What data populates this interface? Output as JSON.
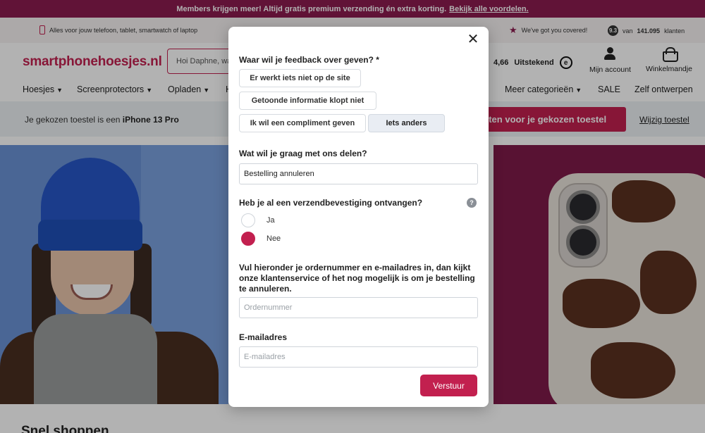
{
  "promo": {
    "text": "Members krijgen meer! Altijd gratis premium verzending én extra korting.",
    "link": "Bekijk alle voordelen."
  },
  "usp": {
    "devices": "Alles voor jouw telefoon, tablet, smartwatch of laptop",
    "covered": "We've got you covered!",
    "rating_badge": "9.3",
    "rating_prefix": "van",
    "rating_count": "141.095",
    "rating_suffix": "klanten"
  },
  "header": {
    "logo": "smartphonehoesjes.nl",
    "search_text": "Hoi Daphne, wa",
    "review_score": "4,66",
    "review_label": "Uitstekend",
    "review_icon_letter": "e",
    "account": "Mijn account",
    "basket": "Winkelmandje"
  },
  "nav": {
    "items": [
      "Hoesjes",
      "Screenprotectors",
      "Opladen",
      "H"
    ],
    "more": "Meer categorieën",
    "sale": "SALE",
    "custom": "Zelf ontwerpen"
  },
  "device_bar": {
    "text_prefix": "Je gekozen toestel is een",
    "device": "iPhone 13 Pro",
    "cta": "cten voor je gekozen toestel",
    "change": "Wijzig toestel"
  },
  "below": {
    "heading": "Snel shoppen"
  },
  "modal": {
    "q1": "Waar wil je feedback over geven? *",
    "options": [
      "Er werkt iets niet op de site",
      "Getoonde informatie klopt niet",
      "Ik wil een compliment geven",
      "Iets anders"
    ],
    "selected_option": "Iets anders",
    "q2": "Wat wil je graag met ons delen?",
    "q2_value": "Bestelling annuleren",
    "q3": "Heb je al een verzendbevestiging ontvangen?",
    "help": "?",
    "radio_yes": "Ja",
    "radio_no": "Nee",
    "radio_selected": "Nee",
    "info": "Vul hieronder je ordernummer en e-mailadres in, dan kijkt onze klantenservice of het nog mogelijk is om je bestelling te annuleren.",
    "order_placeholder": "Ordernummer",
    "email_label": "E-mailadres",
    "email_placeholder": "E-mailadres",
    "submit": "Verstuur"
  },
  "colors": {
    "brand": "#c2204f",
    "promo_bar": "#8c1c4f",
    "hero_maroon": "#7e1b49"
  }
}
